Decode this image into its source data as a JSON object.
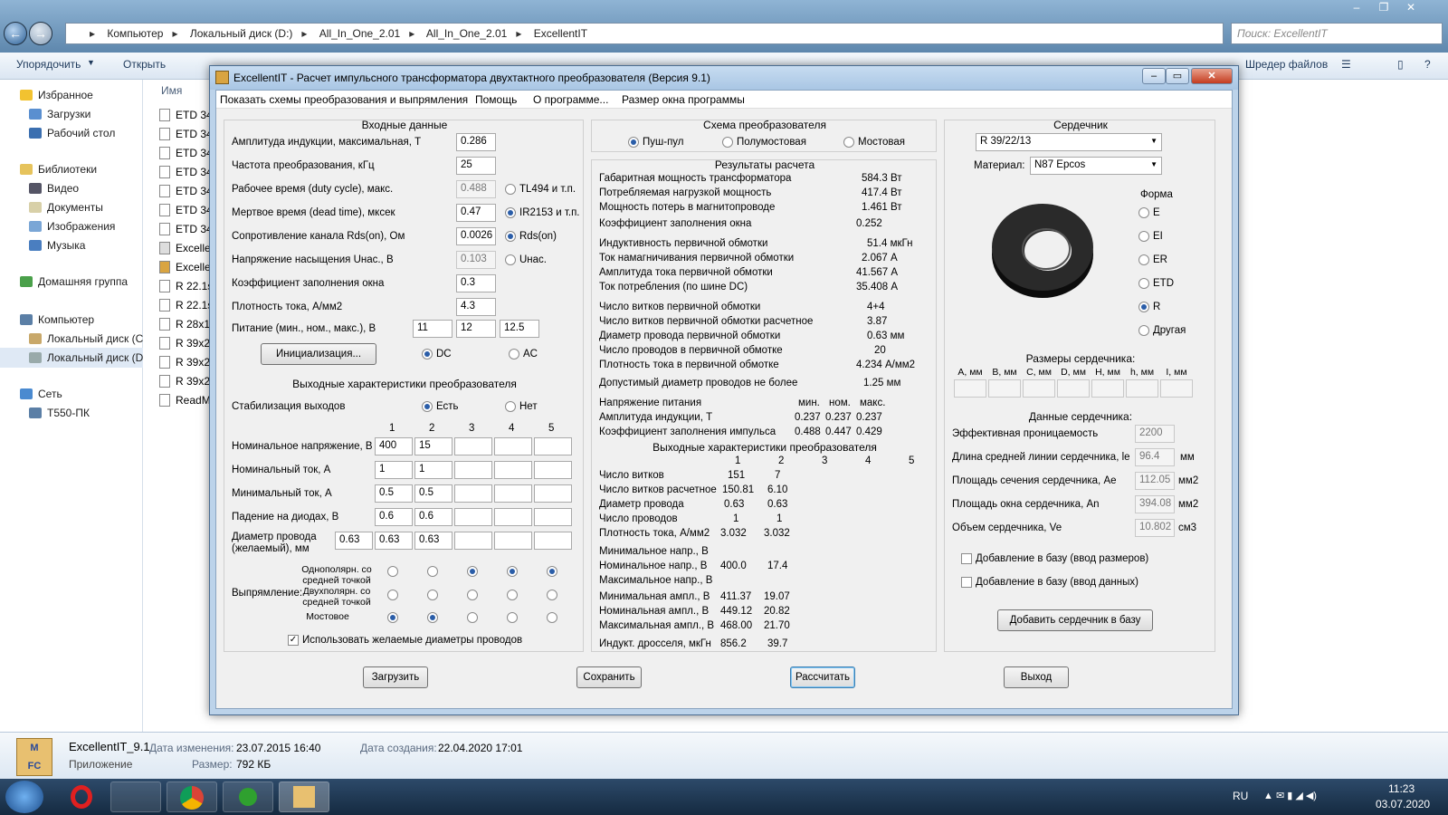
{
  "explorer": {
    "address": [
      "Компьютер",
      "Локальный диск (D:)",
      "All_In_One_2.01",
      "All_In_One_2.01",
      "ExcellentIT"
    ],
    "search_placeholder": "Поиск: ExcellentIT",
    "cmd_organize": "Упорядочить",
    "cmd_open": "Открыть",
    "cmd_shredder": "Шредер файлов",
    "nav": {
      "favorites": "Избранное",
      "downloads": "Загрузки",
      "desktop": "Рабочий стол",
      "libraries": "Библиотеки",
      "video": "Видео",
      "documents": "Документы",
      "images": "Изображения",
      "music": "Музыка",
      "homegroup": "Домашняя группа",
      "computer": "Компьютер",
      "disk_c": "Локальный диск (C",
      "disk_d": "Локальный диск (D",
      "network": "Сеть",
      "pc": "T550-ПК"
    },
    "col_name": "Имя",
    "files": [
      "ETD 34",
      "ETD 34",
      "ETD 34",
      "ETD 34",
      "ETD 34",
      "ETD 34",
      "ETD 34",
      "Excelle",
      "Excelle",
      "R 22.1s",
      "R 22.1s",
      "R 28x1",
      "R 39x2",
      "R 39x2",
      "R 39x2",
      "ReadM"
    ],
    "details": {
      "name": "ExcellentIT_9.1",
      "type": "Приложение",
      "modified_label": "Дата изменения:",
      "modified": "23.07.2015 16:40",
      "created_label": "Дата создания:",
      "created": "22.04.2020 17:01",
      "size_label": "Размер:",
      "size": "792 КБ"
    },
    "tray": {
      "lang": "RU",
      "time": "11:23",
      "date": "03.07.2020"
    }
  },
  "app": {
    "title": "ExcellentIT - Расчет импульсного трансформатора двухтактного преобразователя (Версия 9.1)",
    "menu": [
      "Показать схемы преобразования и выпрямления",
      "Помощь",
      "О программе...",
      "Размер окна программы"
    ],
    "input": {
      "title": "Входные данные",
      "rows": [
        {
          "label": "Амплитуда индукции, максимальная, Т",
          "value": "0.286"
        },
        {
          "label": "Частота преобразования, кГц",
          "value": "25"
        },
        {
          "label": "Рабочее время (duty cycle), макс.",
          "value": "0.488"
        },
        {
          "label": "Мертвое время (dead time), мксек",
          "value": "0.47"
        },
        {
          "label": "Сопротивление канала Rds(on), Ом",
          "value": "0.0026"
        },
        {
          "label": "Напряжение насыщения Uнас., В",
          "value": "0.103"
        },
        {
          "label": "Коэффициент заполнения окна",
          "value": "0.3"
        },
        {
          "label": "Плотность тока, А/мм2",
          "value": "4.3"
        }
      ],
      "opt_tl494": "TL494 и т.п.",
      "opt_ir2153": "IR2153 и т.п.",
      "opt_rds": "Rds(on)",
      "opt_unas": "Uнас.",
      "supply_label": "Питание (мин., ном., макс.), В",
      "supply": [
        "11",
        "12",
        "12.5"
      ],
      "init_btn": "Инициализация...",
      "dc": "DC",
      "ac": "AC"
    },
    "outputs": {
      "title": "Выходные характеристики преобразователя",
      "stab_label": "Стабилизация выходов",
      "yes": "Есть",
      "no": "Нет",
      "cols": [
        "1",
        "2",
        "3",
        "4",
        "5"
      ],
      "rows": [
        {
          "label": "Номинальное напряжение, В",
          "v": [
            "400",
            "15",
            "",
            "",
            ""
          ]
        },
        {
          "label": "Номинальный ток, А",
          "v": [
            "1",
            "1",
            "",
            "",
            ""
          ]
        },
        {
          "label": "Минимальный ток, А",
          "v": [
            "0.5",
            "0.5",
            "",
            "",
            ""
          ]
        },
        {
          "label": "Падение на диодах, В",
          "v": [
            "0.6",
            "0.6",
            "",
            "",
            ""
          ]
        }
      ],
      "wire_label1": "Диаметр провода",
      "wire_label2": "(желаемый), мм",
      "wire": [
        "0.63",
        "0.63",
        "0.63",
        "",
        ""
      ],
      "rect_label": "Выпрямление:",
      "rect_opt1a": "Однополярн. со",
      "rect_opt1b": "средней точкой",
      "rect_opt2a": "Двухполярн. со",
      "rect_opt2b": "средней точкой",
      "rect_opt3": "Мостовое",
      "use_wire": "Использовать желаемые диаметры проводов"
    },
    "scheme": {
      "title": "Схема преобразователя",
      "opts": [
        "Пуш-пул",
        "Полумостовая",
        "Мостовая"
      ]
    },
    "results": {
      "title": "Результаты расчета",
      "g1": [
        [
          "Габаритная мощность трансформатора",
          "584.3 Вт"
        ],
        [
          "Потребляемая нагрузкой мощность",
          "417.4 Вт"
        ],
        [
          "Мощность потерь в магнитопроводе",
          "1.461 Вт"
        ],
        [
          "Коэффициент заполнения окна",
          "0.252"
        ]
      ],
      "g2": [
        [
          "Индуктивность первичной обмотки",
          "51.4 мкГн"
        ],
        [
          "Ток намагничивания первичной обмотки",
          "2.067 А"
        ],
        [
          "Амплитуда тока первичной обмотки",
          "41.567 А"
        ],
        [
          "Ток потребления (по шине DC)",
          "35.408 А"
        ]
      ],
      "g3": [
        [
          "Число витков первичной обмотки",
          "4+4"
        ],
        [
          "Число витков первичной обмотки расчетное",
          "3.87"
        ],
        [
          "Диаметр провода первичной обмотки",
          "0.63 мм"
        ],
        [
          "Число проводов в первичной обмотке",
          "20"
        ],
        [
          "Плотность тока в первичной обмотке",
          "4.234 А/мм2"
        ]
      ],
      "g4": [
        [
          "Допустимый диаметр проводов не более",
          "1.25 мм"
        ]
      ],
      "mnm_head": [
        "мин.",
        "ном.",
        "макс."
      ],
      "mnm": [
        [
          "Напряжение питания",
          "",
          "",
          ""
        ],
        [
          "Амплитуда индукции, Т",
          "0.237",
          "0.237",
          "0.237"
        ],
        [
          "Коэффициент заполнения импульса",
          "0.488",
          "0.447",
          "0.429"
        ]
      ],
      "out_title": "Выходные характеристики преобразователя",
      "out_cols": [
        "1",
        "2",
        "3",
        "4",
        "5"
      ],
      "out_a": [
        [
          "Число витков",
          "151",
          "7"
        ],
        [
          "Число витков расчетное",
          "150.81",
          "6.10"
        ],
        [
          "Диаметр провода",
          "0.63",
          "0.63"
        ],
        [
          "Число проводов",
          "1",
          "1"
        ],
        [
          "Плотность тока, А/мм2",
          "3.032",
          "3.032"
        ]
      ],
      "out_b": [
        [
          "Минимальное напр., В",
          "",
          ""
        ],
        [
          "Номинальное напр., В",
          "400.0",
          "17.4"
        ],
        [
          "Максимальное напр., В",
          "",
          ""
        ]
      ],
      "out_c": [
        [
          "Минимальная ампл., В",
          "411.37",
          "19.07"
        ],
        [
          "Номинальная ампл., В",
          "449.12",
          "20.82"
        ],
        [
          "Максимальная ампл., В",
          "468.00",
          "21.70"
        ]
      ],
      "out_d": [
        [
          "Индукт. дросселя, мкГн",
          "856.2",
          "39.7"
        ]
      ]
    },
    "core": {
      "title": "Сердечник",
      "model": "R 39/22/13",
      "material_label": "Материал:",
      "material": "N87 Epcos",
      "shape_label": "Форма",
      "shapes": [
        "E",
        "EI",
        "ER",
        "ETD",
        "R",
        "Другая"
      ],
      "dims_label": "Размеры сердечника:",
      "dims": [
        "A, мм",
        "B, мм",
        "C, мм",
        "D, мм",
        "H, мм",
        "h, мм",
        "I, мм"
      ],
      "data_label": "Данные сердечника:",
      "data": [
        [
          "Эффективная проницаемость",
          "2200",
          ""
        ],
        [
          "Длина средней линии сердечника, le",
          "96.4",
          "мм"
        ],
        [
          "Площадь сечения сердечника, Ae",
          "112.05",
          "мм2"
        ],
        [
          "Площадь окна сердечника, An",
          "394.08",
          "мм2"
        ],
        [
          "Объем сердечника, Ve",
          "10.802",
          "см3"
        ]
      ],
      "add_dims": "Добавление в базу (ввод размеров)",
      "add_data": "Добавление в базу (ввод данных)",
      "add_btn": "Добавить сердечник в базу"
    },
    "buttons": {
      "load": "Загрузить",
      "save": "Сохранить",
      "calc": "Рассчитать",
      "exit": "Выход"
    }
  }
}
